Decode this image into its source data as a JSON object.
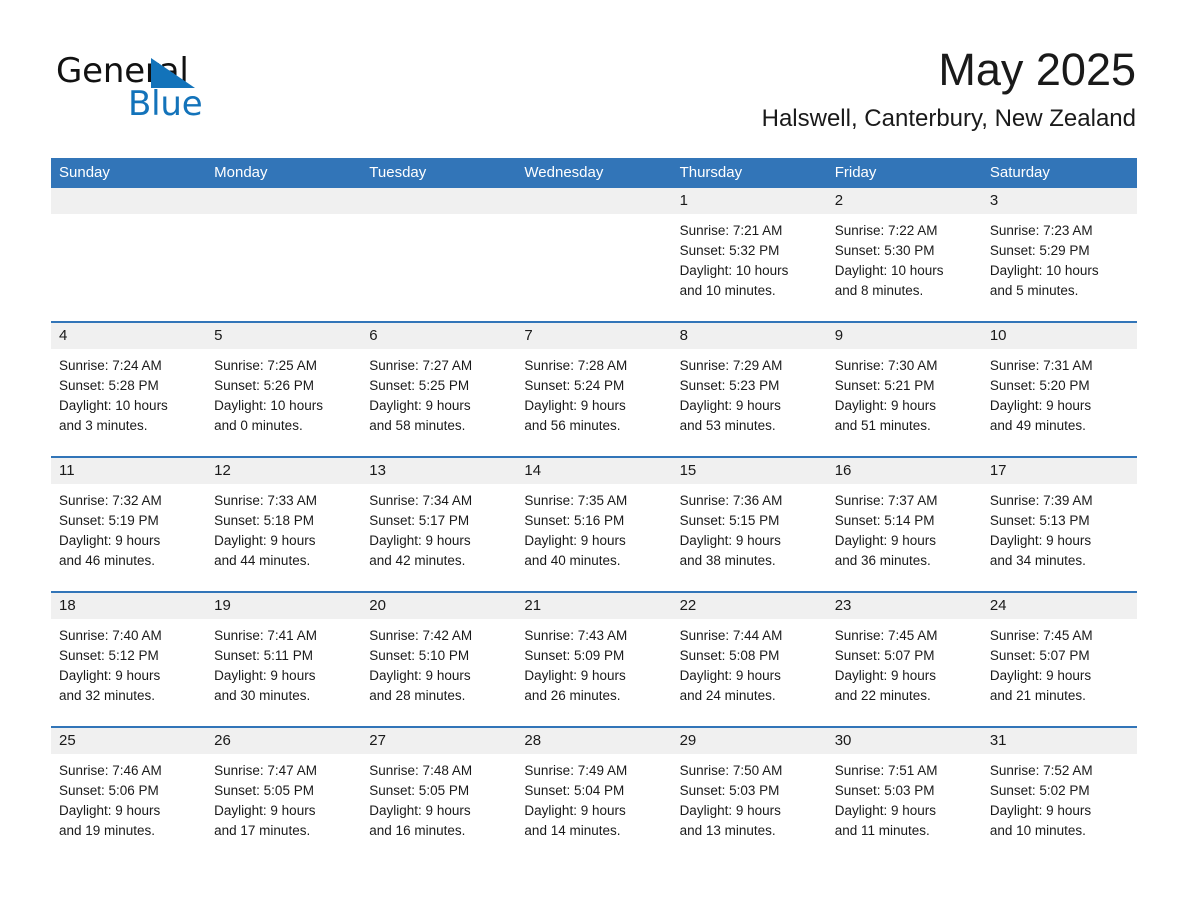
{
  "brand": {
    "name_part1": "General",
    "name_part2": "Blue",
    "triangle_icon": "blue-triangle-logo-mark",
    "accent_color": "#1373BA"
  },
  "header": {
    "month_title": "May 2025",
    "location": "Halswell, Canterbury, New Zealand"
  },
  "theme": {
    "header_blue": "#3275B8",
    "day_band_gray": "#f0f0f0",
    "cell_white": "#ffffff",
    "text_dark": "#1a1a1a"
  },
  "weekdays": [
    "Sunday",
    "Monday",
    "Tuesday",
    "Wednesday",
    "Thursday",
    "Friday",
    "Saturday"
  ],
  "weeks": [
    {
      "days": [
        {
          "num": "",
          "sunrise": "",
          "sunset": "",
          "daylight_line1": "",
          "daylight_line2": "",
          "empty": true
        },
        {
          "num": "",
          "sunrise": "",
          "sunset": "",
          "daylight_line1": "",
          "daylight_line2": "",
          "empty": true
        },
        {
          "num": "",
          "sunrise": "",
          "sunset": "",
          "daylight_line1": "",
          "daylight_line2": "",
          "empty": true
        },
        {
          "num": "",
          "sunrise": "",
          "sunset": "",
          "daylight_line1": "",
          "daylight_line2": "",
          "empty": true
        },
        {
          "num": "1",
          "sunrise": "Sunrise: 7:21 AM",
          "sunset": "Sunset: 5:32 PM",
          "daylight_line1": "Daylight: 10 hours",
          "daylight_line2": "and 10 minutes.",
          "empty": false
        },
        {
          "num": "2",
          "sunrise": "Sunrise: 7:22 AM",
          "sunset": "Sunset: 5:30 PM",
          "daylight_line1": "Daylight: 10 hours",
          "daylight_line2": "and 8 minutes.",
          "empty": false
        },
        {
          "num": "3",
          "sunrise": "Sunrise: 7:23 AM",
          "sunset": "Sunset: 5:29 PM",
          "daylight_line1": "Daylight: 10 hours",
          "daylight_line2": "and 5 minutes.",
          "empty": false
        }
      ]
    },
    {
      "days": [
        {
          "num": "4",
          "sunrise": "Sunrise: 7:24 AM",
          "sunset": "Sunset: 5:28 PM",
          "daylight_line1": "Daylight: 10 hours",
          "daylight_line2": "and 3 minutes.",
          "empty": false
        },
        {
          "num": "5",
          "sunrise": "Sunrise: 7:25 AM",
          "sunset": "Sunset: 5:26 PM",
          "daylight_line1": "Daylight: 10 hours",
          "daylight_line2": "and 0 minutes.",
          "empty": false
        },
        {
          "num": "6",
          "sunrise": "Sunrise: 7:27 AM",
          "sunset": "Sunset: 5:25 PM",
          "daylight_line1": "Daylight: 9 hours",
          "daylight_line2": "and 58 minutes.",
          "empty": false
        },
        {
          "num": "7",
          "sunrise": "Sunrise: 7:28 AM",
          "sunset": "Sunset: 5:24 PM",
          "daylight_line1": "Daylight: 9 hours",
          "daylight_line2": "and 56 minutes.",
          "empty": false
        },
        {
          "num": "8",
          "sunrise": "Sunrise: 7:29 AM",
          "sunset": "Sunset: 5:23 PM",
          "daylight_line1": "Daylight: 9 hours",
          "daylight_line2": "and 53 minutes.",
          "empty": false
        },
        {
          "num": "9",
          "sunrise": "Sunrise: 7:30 AM",
          "sunset": "Sunset: 5:21 PM",
          "daylight_line1": "Daylight: 9 hours",
          "daylight_line2": "and 51 minutes.",
          "empty": false
        },
        {
          "num": "10",
          "sunrise": "Sunrise: 7:31 AM",
          "sunset": "Sunset: 5:20 PM",
          "daylight_line1": "Daylight: 9 hours",
          "daylight_line2": "and 49 minutes.",
          "empty": false
        }
      ]
    },
    {
      "days": [
        {
          "num": "11",
          "sunrise": "Sunrise: 7:32 AM",
          "sunset": "Sunset: 5:19 PM",
          "daylight_line1": "Daylight: 9 hours",
          "daylight_line2": "and 46 minutes.",
          "empty": false
        },
        {
          "num": "12",
          "sunrise": "Sunrise: 7:33 AM",
          "sunset": "Sunset: 5:18 PM",
          "daylight_line1": "Daylight: 9 hours",
          "daylight_line2": "and 44 minutes.",
          "empty": false
        },
        {
          "num": "13",
          "sunrise": "Sunrise: 7:34 AM",
          "sunset": "Sunset: 5:17 PM",
          "daylight_line1": "Daylight: 9 hours",
          "daylight_line2": "and 42 minutes.",
          "empty": false
        },
        {
          "num": "14",
          "sunrise": "Sunrise: 7:35 AM",
          "sunset": "Sunset: 5:16 PM",
          "daylight_line1": "Daylight: 9 hours",
          "daylight_line2": "and 40 minutes.",
          "empty": false
        },
        {
          "num": "15",
          "sunrise": "Sunrise: 7:36 AM",
          "sunset": "Sunset: 5:15 PM",
          "daylight_line1": "Daylight: 9 hours",
          "daylight_line2": "and 38 minutes.",
          "empty": false
        },
        {
          "num": "16",
          "sunrise": "Sunrise: 7:37 AM",
          "sunset": "Sunset: 5:14 PM",
          "daylight_line1": "Daylight: 9 hours",
          "daylight_line2": "and 36 minutes.",
          "empty": false
        },
        {
          "num": "17",
          "sunrise": "Sunrise: 7:39 AM",
          "sunset": "Sunset: 5:13 PM",
          "daylight_line1": "Daylight: 9 hours",
          "daylight_line2": "and 34 minutes.",
          "empty": false
        }
      ]
    },
    {
      "days": [
        {
          "num": "18",
          "sunrise": "Sunrise: 7:40 AM",
          "sunset": "Sunset: 5:12 PM",
          "daylight_line1": "Daylight: 9 hours",
          "daylight_line2": "and 32 minutes.",
          "empty": false
        },
        {
          "num": "19",
          "sunrise": "Sunrise: 7:41 AM",
          "sunset": "Sunset: 5:11 PM",
          "daylight_line1": "Daylight: 9 hours",
          "daylight_line2": "and 30 minutes.",
          "empty": false
        },
        {
          "num": "20",
          "sunrise": "Sunrise: 7:42 AM",
          "sunset": "Sunset: 5:10 PM",
          "daylight_line1": "Daylight: 9 hours",
          "daylight_line2": "and 28 minutes.",
          "empty": false
        },
        {
          "num": "21",
          "sunrise": "Sunrise: 7:43 AM",
          "sunset": "Sunset: 5:09 PM",
          "daylight_line1": "Daylight: 9 hours",
          "daylight_line2": "and 26 minutes.",
          "empty": false
        },
        {
          "num": "22",
          "sunrise": "Sunrise: 7:44 AM",
          "sunset": "Sunset: 5:08 PM",
          "daylight_line1": "Daylight: 9 hours",
          "daylight_line2": "and 24 minutes.",
          "empty": false
        },
        {
          "num": "23",
          "sunrise": "Sunrise: 7:45 AM",
          "sunset": "Sunset: 5:07 PM",
          "daylight_line1": "Daylight: 9 hours",
          "daylight_line2": "and 22 minutes.",
          "empty": false
        },
        {
          "num": "24",
          "sunrise": "Sunrise: 7:45 AM",
          "sunset": "Sunset: 5:07 PM",
          "daylight_line1": "Daylight: 9 hours",
          "daylight_line2": "and 21 minutes.",
          "empty": false
        }
      ]
    },
    {
      "days": [
        {
          "num": "25",
          "sunrise": "Sunrise: 7:46 AM",
          "sunset": "Sunset: 5:06 PM",
          "daylight_line1": "Daylight: 9 hours",
          "daylight_line2": "and 19 minutes.",
          "empty": false
        },
        {
          "num": "26",
          "sunrise": "Sunrise: 7:47 AM",
          "sunset": "Sunset: 5:05 PM",
          "daylight_line1": "Daylight: 9 hours",
          "daylight_line2": "and 17 minutes.",
          "empty": false
        },
        {
          "num": "27",
          "sunrise": "Sunrise: 7:48 AM",
          "sunset": "Sunset: 5:05 PM",
          "daylight_line1": "Daylight: 9 hours",
          "daylight_line2": "and 16 minutes.",
          "empty": false
        },
        {
          "num": "28",
          "sunrise": "Sunrise: 7:49 AM",
          "sunset": "Sunset: 5:04 PM",
          "daylight_line1": "Daylight: 9 hours",
          "daylight_line2": "and 14 minutes.",
          "empty": false
        },
        {
          "num": "29",
          "sunrise": "Sunrise: 7:50 AM",
          "sunset": "Sunset: 5:03 PM",
          "daylight_line1": "Daylight: 9 hours",
          "daylight_line2": "and 13 minutes.",
          "empty": false
        },
        {
          "num": "30",
          "sunrise": "Sunrise: 7:51 AM",
          "sunset": "Sunset: 5:03 PM",
          "daylight_line1": "Daylight: 9 hours",
          "daylight_line2": "and 11 minutes.",
          "empty": false
        },
        {
          "num": "31",
          "sunrise": "Sunrise: 7:52 AM",
          "sunset": "Sunset: 5:02 PM",
          "daylight_line1": "Daylight: 9 hours",
          "daylight_line2": "and 10 minutes.",
          "empty": false
        }
      ]
    }
  ]
}
